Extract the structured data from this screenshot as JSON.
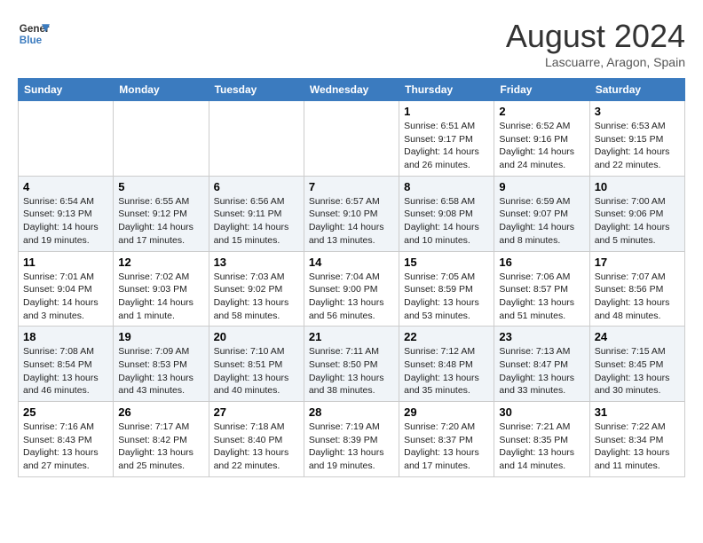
{
  "logo": {
    "text_general": "General",
    "text_blue": "Blue"
  },
  "header": {
    "title": "August 2024",
    "subtitle": "Lascuarre, Aragon, Spain"
  },
  "weekdays": [
    "Sunday",
    "Monday",
    "Tuesday",
    "Wednesday",
    "Thursday",
    "Friday",
    "Saturday"
  ],
  "weeks": [
    [
      {
        "day": "",
        "info": ""
      },
      {
        "day": "",
        "info": ""
      },
      {
        "day": "",
        "info": ""
      },
      {
        "day": "",
        "info": ""
      },
      {
        "day": "1",
        "info": "Sunrise: 6:51 AM\nSunset: 9:17 PM\nDaylight: 14 hours\nand 26 minutes."
      },
      {
        "day": "2",
        "info": "Sunrise: 6:52 AM\nSunset: 9:16 PM\nDaylight: 14 hours\nand 24 minutes."
      },
      {
        "day": "3",
        "info": "Sunrise: 6:53 AM\nSunset: 9:15 PM\nDaylight: 14 hours\nand 22 minutes."
      }
    ],
    [
      {
        "day": "4",
        "info": "Sunrise: 6:54 AM\nSunset: 9:13 PM\nDaylight: 14 hours\nand 19 minutes."
      },
      {
        "day": "5",
        "info": "Sunrise: 6:55 AM\nSunset: 9:12 PM\nDaylight: 14 hours\nand 17 minutes."
      },
      {
        "day": "6",
        "info": "Sunrise: 6:56 AM\nSunset: 9:11 PM\nDaylight: 14 hours\nand 15 minutes."
      },
      {
        "day": "7",
        "info": "Sunrise: 6:57 AM\nSunset: 9:10 PM\nDaylight: 14 hours\nand 13 minutes."
      },
      {
        "day": "8",
        "info": "Sunrise: 6:58 AM\nSunset: 9:08 PM\nDaylight: 14 hours\nand 10 minutes."
      },
      {
        "day": "9",
        "info": "Sunrise: 6:59 AM\nSunset: 9:07 PM\nDaylight: 14 hours\nand 8 minutes."
      },
      {
        "day": "10",
        "info": "Sunrise: 7:00 AM\nSunset: 9:06 PM\nDaylight: 14 hours\nand 5 minutes."
      }
    ],
    [
      {
        "day": "11",
        "info": "Sunrise: 7:01 AM\nSunset: 9:04 PM\nDaylight: 14 hours\nand 3 minutes."
      },
      {
        "day": "12",
        "info": "Sunrise: 7:02 AM\nSunset: 9:03 PM\nDaylight: 14 hours\nand 1 minute."
      },
      {
        "day": "13",
        "info": "Sunrise: 7:03 AM\nSunset: 9:02 PM\nDaylight: 13 hours\nand 58 minutes."
      },
      {
        "day": "14",
        "info": "Sunrise: 7:04 AM\nSunset: 9:00 PM\nDaylight: 13 hours\nand 56 minutes."
      },
      {
        "day": "15",
        "info": "Sunrise: 7:05 AM\nSunset: 8:59 PM\nDaylight: 13 hours\nand 53 minutes."
      },
      {
        "day": "16",
        "info": "Sunrise: 7:06 AM\nSunset: 8:57 PM\nDaylight: 13 hours\nand 51 minutes."
      },
      {
        "day": "17",
        "info": "Sunrise: 7:07 AM\nSunset: 8:56 PM\nDaylight: 13 hours\nand 48 minutes."
      }
    ],
    [
      {
        "day": "18",
        "info": "Sunrise: 7:08 AM\nSunset: 8:54 PM\nDaylight: 13 hours\nand 46 minutes."
      },
      {
        "day": "19",
        "info": "Sunrise: 7:09 AM\nSunset: 8:53 PM\nDaylight: 13 hours\nand 43 minutes."
      },
      {
        "day": "20",
        "info": "Sunrise: 7:10 AM\nSunset: 8:51 PM\nDaylight: 13 hours\nand 40 minutes."
      },
      {
        "day": "21",
        "info": "Sunrise: 7:11 AM\nSunset: 8:50 PM\nDaylight: 13 hours\nand 38 minutes."
      },
      {
        "day": "22",
        "info": "Sunrise: 7:12 AM\nSunset: 8:48 PM\nDaylight: 13 hours\nand 35 minutes."
      },
      {
        "day": "23",
        "info": "Sunrise: 7:13 AM\nSunset: 8:47 PM\nDaylight: 13 hours\nand 33 minutes."
      },
      {
        "day": "24",
        "info": "Sunrise: 7:15 AM\nSunset: 8:45 PM\nDaylight: 13 hours\nand 30 minutes."
      }
    ],
    [
      {
        "day": "25",
        "info": "Sunrise: 7:16 AM\nSunset: 8:43 PM\nDaylight: 13 hours\nand 27 minutes."
      },
      {
        "day": "26",
        "info": "Sunrise: 7:17 AM\nSunset: 8:42 PM\nDaylight: 13 hours\nand 25 minutes."
      },
      {
        "day": "27",
        "info": "Sunrise: 7:18 AM\nSunset: 8:40 PM\nDaylight: 13 hours\nand 22 minutes."
      },
      {
        "day": "28",
        "info": "Sunrise: 7:19 AM\nSunset: 8:39 PM\nDaylight: 13 hours\nand 19 minutes."
      },
      {
        "day": "29",
        "info": "Sunrise: 7:20 AM\nSunset: 8:37 PM\nDaylight: 13 hours\nand 17 minutes."
      },
      {
        "day": "30",
        "info": "Sunrise: 7:21 AM\nSunset: 8:35 PM\nDaylight: 13 hours\nand 14 minutes."
      },
      {
        "day": "31",
        "info": "Sunrise: 7:22 AM\nSunset: 8:34 PM\nDaylight: 13 hours\nand 11 minutes."
      }
    ]
  ]
}
